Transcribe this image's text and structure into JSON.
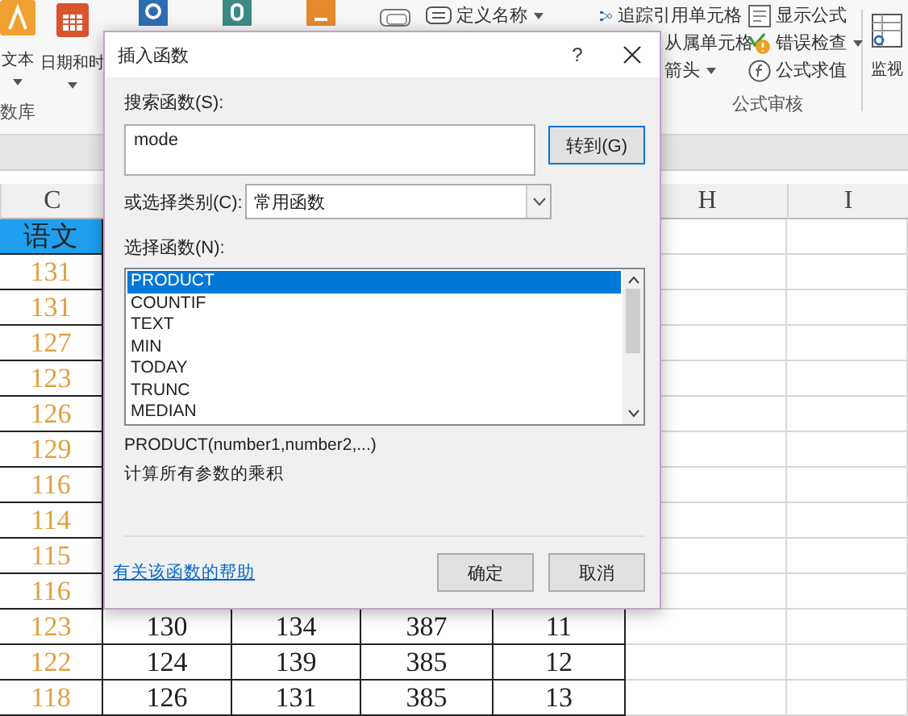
{
  "ribbon": {
    "large_buttons": [
      {
        "label": "文本",
        "menu": true
      },
      {
        "label": "日期和时",
        "menu": true
      }
    ],
    "group_labels": [
      "数库",
      "公式审核"
    ],
    "name_button": {
      "label": "定义名称",
      "menu": true
    },
    "audit_columns": [
      [
        {
          "label": "追踪引用单元格",
          "kind": "full",
          "menu": false
        },
        {
          "label": "从属单元格",
          "kind": "partial",
          "menu": false
        },
        {
          "label": "箭头",
          "kind": "partial",
          "menu": true
        }
      ],
      [
        {
          "label": "显示公式",
          "kind": "full",
          "menu": false
        },
        {
          "label": "错误检查",
          "kind": "full",
          "menu": true
        },
        {
          "label": "公式求值",
          "kind": "full",
          "menu": false
        }
      ]
    ],
    "watch_button": {
      "label": "监视"
    }
  },
  "sheet": {
    "column_headers": [
      "C",
      "H",
      "I"
    ],
    "header_cell": "语文",
    "column_c": [
      "131",
      "131",
      "127",
      "123",
      "126",
      "129",
      "116",
      "114",
      "115",
      "116",
      "123",
      "122",
      "118"
    ],
    "lower_rows": [
      [
        "130",
        "134",
        "387",
        "11"
      ],
      [
        "124",
        "139",
        "385",
        "12"
      ],
      [
        "126",
        "131",
        "385",
        "13"
      ]
    ]
  },
  "dialog": {
    "title": "插入函数",
    "help": "?",
    "search_label": "搜索函数(S):",
    "search_value": "mode",
    "go_button": "转到(G)",
    "category_label": "或选择类别(C):",
    "category_value": "常用函数",
    "list_label": "选择函数(N):",
    "functions": [
      {
        "name": "PRODUCT",
        "selected": true
      },
      {
        "name": "COUNTIF",
        "selected": false
      },
      {
        "name": "TEXT",
        "selected": false
      },
      {
        "name": "MIN",
        "selected": false
      },
      {
        "name": "TODAY",
        "selected": false
      },
      {
        "name": "TRUNC",
        "selected": false
      },
      {
        "name": "MEDIAN",
        "selected": false
      }
    ],
    "syntax": "PRODUCT(number1,number2,...)",
    "description": "计算所有参数的乘积",
    "help_link": "有关该函数的帮助",
    "buttons": [
      "确定",
      "取消"
    ]
  }
}
